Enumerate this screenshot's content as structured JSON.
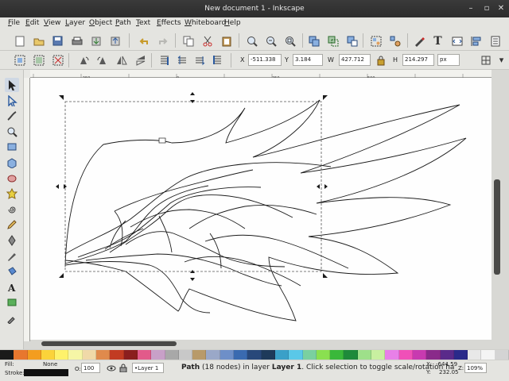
{
  "window": {
    "title": "New document 1 - Inkscape",
    "buttons": [
      "–",
      "▫",
      "✕"
    ]
  },
  "menu": [
    "File",
    "Edit",
    "View",
    "Layer",
    "Object",
    "Path",
    "Text",
    "Effects",
    "Whiteboard",
    "Help"
  ],
  "toolbar_top": {
    "icons": [
      "new-icon",
      "open-icon",
      "save-icon",
      "print-icon",
      "import-icon",
      "export-icon",
      "undo-icon",
      "redo-icon",
      "copy-icon",
      "cut-icon",
      "paste-icon",
      "zoom-selection-icon",
      "zoom-drawing-icon",
      "zoom-page-icon",
      "duplicate-icon",
      "clone-icon",
      "unlink-clone-icon",
      "group-icon",
      "ungroup-icon",
      "fill-stroke-icon",
      "text-font-icon",
      "xml-editor-icon",
      "align-distribute-icon",
      "preferences-icon"
    ]
  },
  "toolbar_select": {
    "x_label": "X",
    "x_value": "-511.338",
    "y_label": "Y",
    "y_value": "3.184",
    "w_label": "W",
    "w_value": "427.712",
    "h_label": "H",
    "h_value": "214.297",
    "unit": "px"
  },
  "rulers": {
    "h_ticks": [
      "-250",
      "0",
      "250",
      "500"
    ]
  },
  "tools": [
    "selector-tool-icon",
    "node-tool-icon",
    "tweak-tool-icon",
    "zoom-tool-icon",
    "rect-tool-icon",
    "3dbox-tool-icon",
    "ellipse-tool-icon",
    "star-tool-icon",
    "spiral-tool-icon",
    "pencil-tool-icon",
    "pen-tool-icon",
    "calligraphy-tool-icon",
    "bucket-tool-icon",
    "text-tool-icon",
    "gradient-tool-icon",
    "dropper-tool-icon"
  ],
  "palette": [
    "#1a1a1a",
    "#e8772e",
    "#f39d1f",
    "#fbd33a",
    "#fef26b",
    "#f6f6a6",
    "#f0d9a8",
    "#e08a4c",
    "#c23b22",
    "#8b1e1e",
    "#e25a8a",
    "#c8a0c8",
    "#a8a8a8",
    "#c8c8c8",
    "#b89a6a",
    "#9aa8c8",
    "#6e8fc8",
    "#3a6ab0",
    "#28487a",
    "#1e3a5a",
    "#3aa0c8",
    "#5ac8e8",
    "#7ad0a0",
    "#8ae050",
    "#3ab83a",
    "#1e8a3a",
    "#9ee08a",
    "#c8f0a0",
    "#e880e8",
    "#f050b8",
    "#c83ab0",
    "#8a2a8a",
    "#5a2a8a",
    "#2a2a8a",
    "#e8e8e8",
    "#f4f4f4",
    "#d4d4d4"
  ],
  "status": {
    "fill_label": "Fill:",
    "fill_value": "None",
    "stroke_label": "Stroke:",
    "opacity_label": "O:",
    "opacity_value": "100",
    "layer": "•Layer 1",
    "message_prefix": "Path",
    "message_detail": "(18 nodes) in layer",
    "message_layer": "Layer 1",
    "message_tail": ". Click selection to toggle scale/rotation ha",
    "x_label": "X:",
    "x_value": "-644.59",
    "y_label": "Y:",
    "y_value": "232.05",
    "zoom_label": "Z:",
    "zoom_value": "109%"
  }
}
